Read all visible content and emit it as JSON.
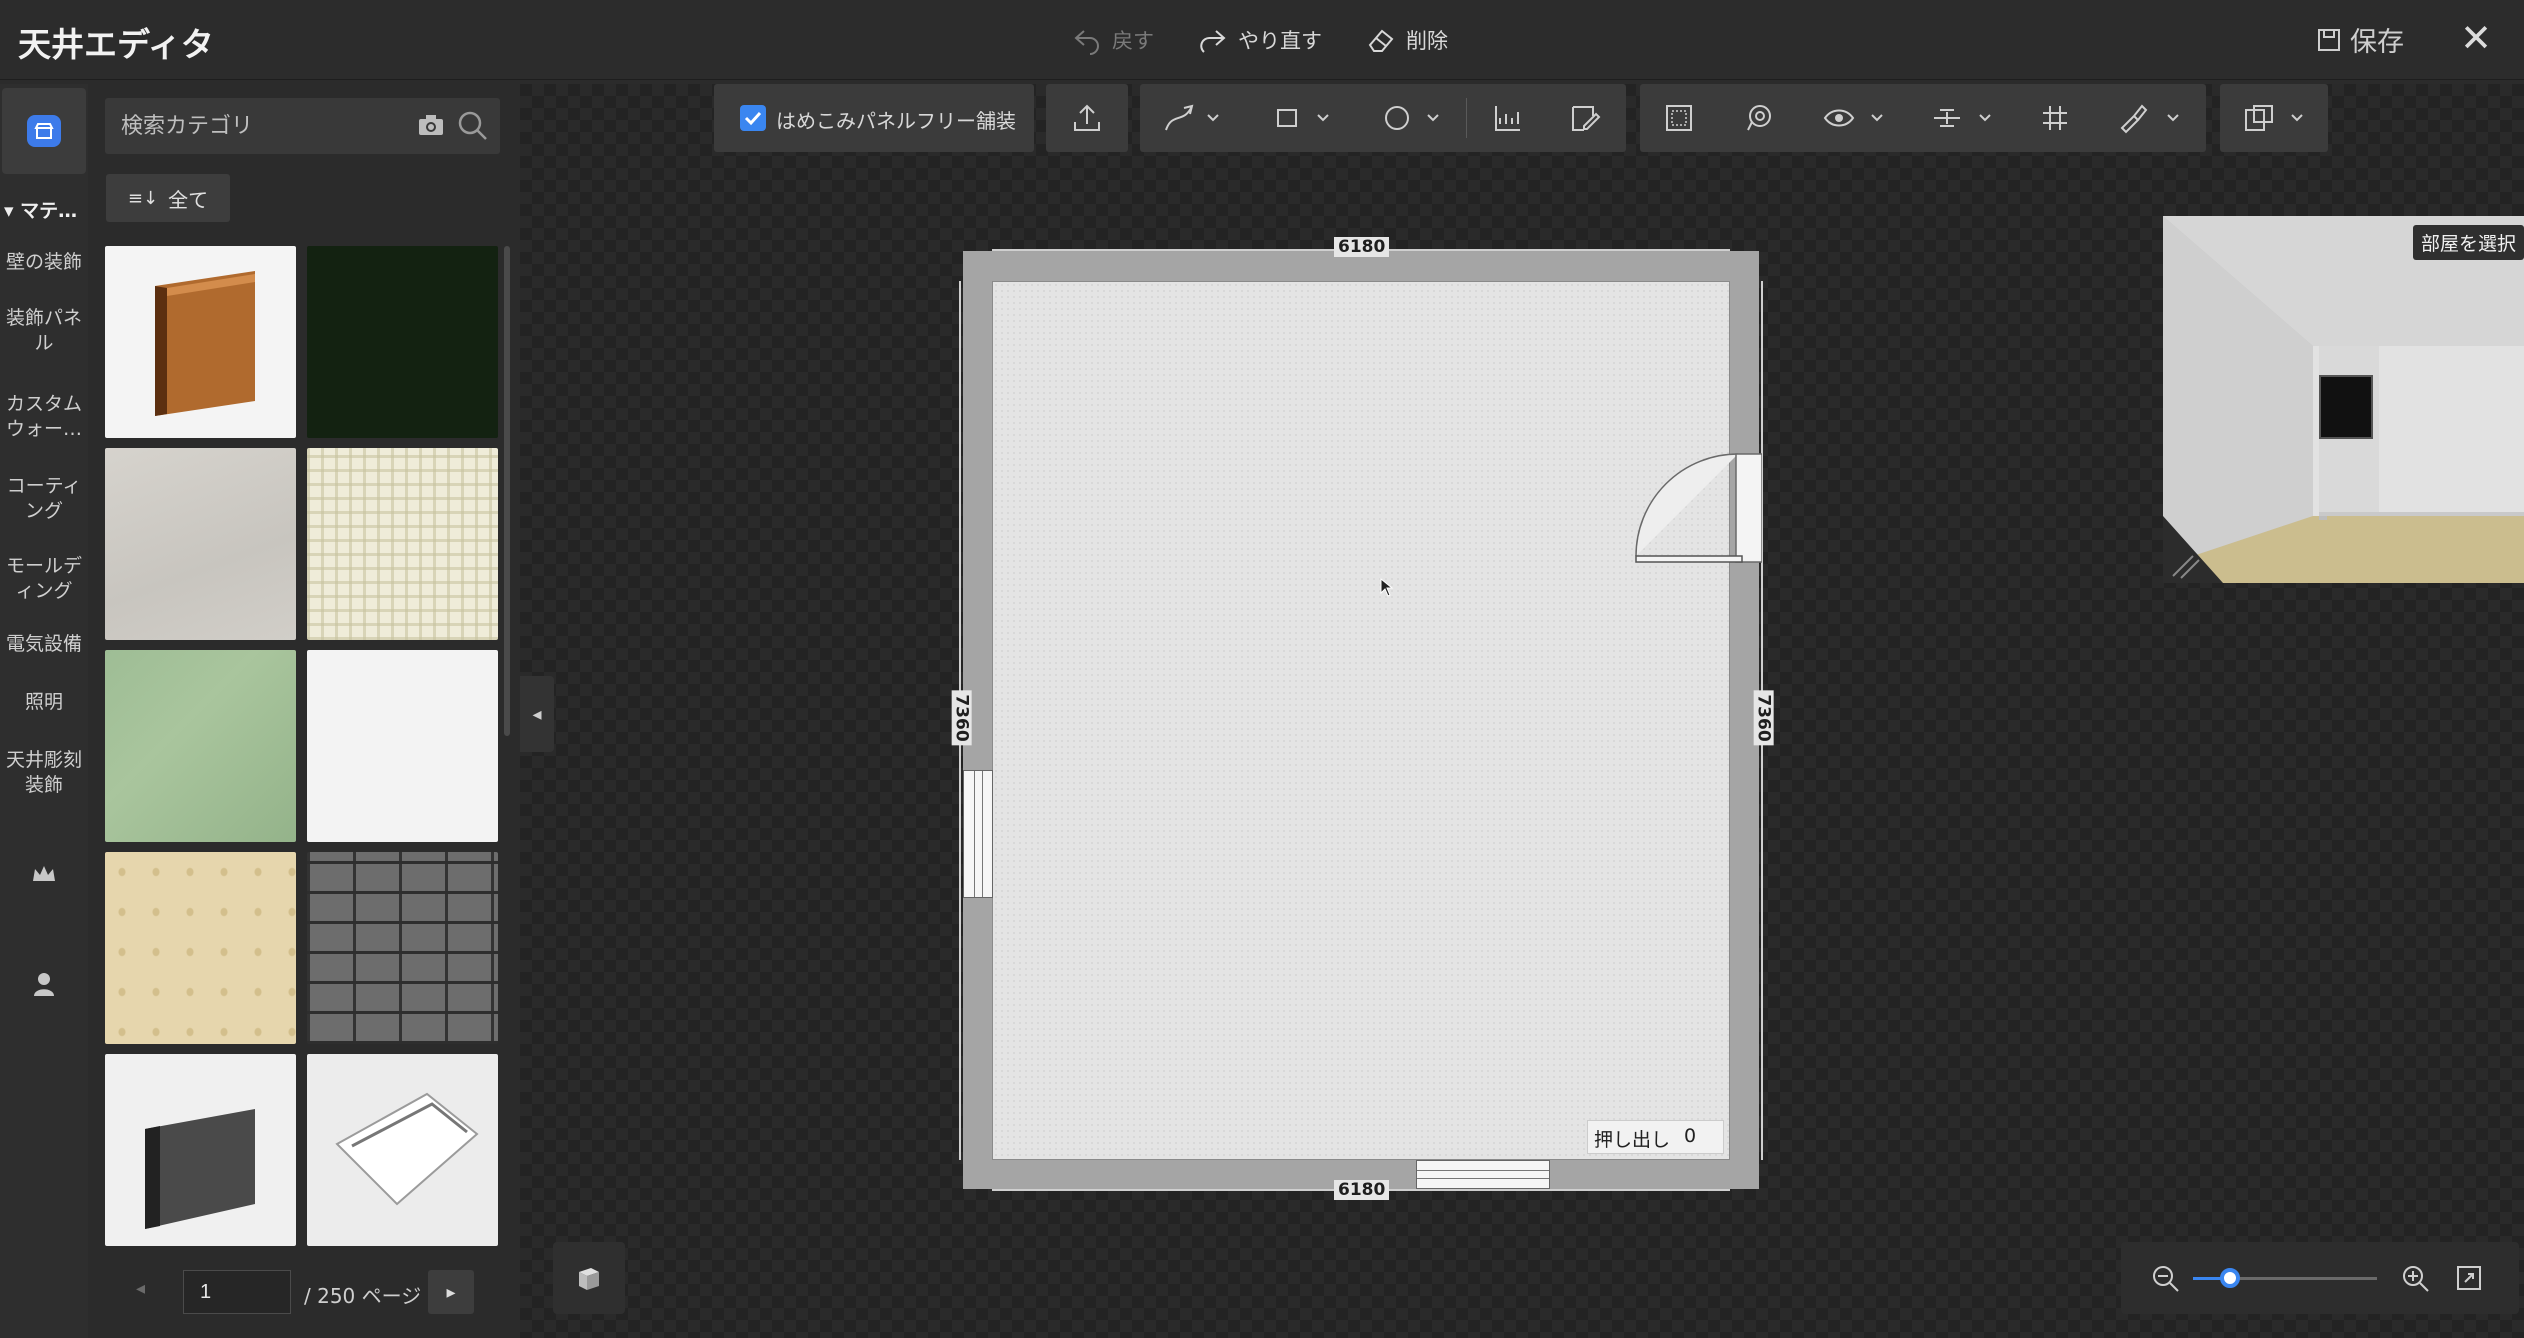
{
  "app": {
    "title": "天井エディタ"
  },
  "titlebar": {
    "undo_label": "戻す",
    "redo_label": "やり直す",
    "delete_label": "削除",
    "save_label": "保存",
    "close_label": "✕"
  },
  "rail": {
    "category_header": "マテ…",
    "items": [
      {
        "label": "壁の装飾"
      },
      {
        "label": "装飾パネル"
      },
      {
        "label": "カスタムウォー…"
      },
      {
        "label": "コーティング"
      },
      {
        "label": "モールディング"
      },
      {
        "label": "電気設備"
      },
      {
        "label": "照明"
      },
      {
        "label": "天井彫刻装飾"
      }
    ],
    "icons": [
      "store-icon",
      "crown-icon",
      "user-icon"
    ]
  },
  "catalog": {
    "search_placeholder": "検索カテゴリ",
    "filter_label": "全て",
    "tiles": [
      {
        "name": "wood-baseboard"
      },
      {
        "name": "dark-green-solid"
      },
      {
        "name": "grey-plaster"
      },
      {
        "name": "cream-check-pattern"
      },
      {
        "name": "green-texture"
      },
      {
        "name": "white-texture"
      },
      {
        "name": "beige-damask"
      },
      {
        "name": "grey-stone-wall"
      },
      {
        "name": "grey-skirting"
      },
      {
        "name": "white-crown-molding"
      }
    ],
    "pager": {
      "current_page": "1",
      "total_label": "/ 250 ページ"
    }
  },
  "toolbar": {
    "panel_toggle_label": "はめこみパネルフリー舗装",
    "panel_toggle_checked": true
  },
  "plan": {
    "width_top": "6180",
    "width_bottom": "6180",
    "height_left": "7360",
    "height_right": "7360",
    "extrude_label": "押し出し",
    "extrude_value": "0"
  },
  "preview": {
    "room_select_label": "部屋を選択"
  },
  "zoom": {
    "level": 0.2
  },
  "colors": {
    "accent": "#3a86f0",
    "wall": "#a5a5a5",
    "floor": "#e4e4e4"
  }
}
